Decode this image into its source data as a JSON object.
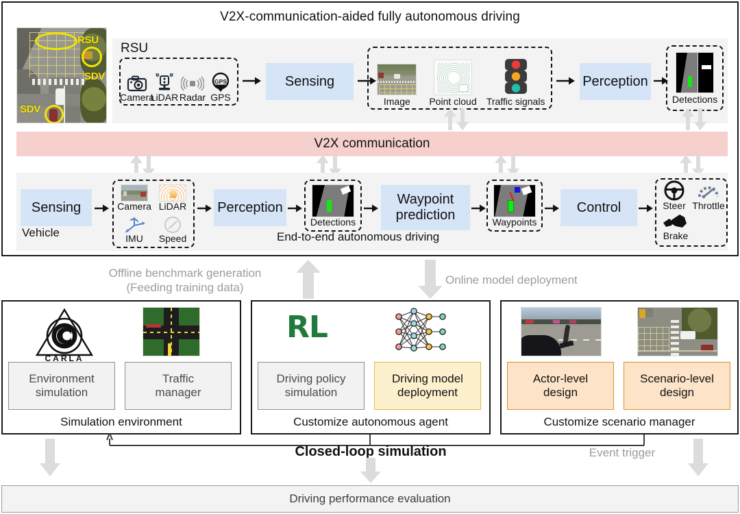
{
  "top": {
    "title": "V2X-communication-aided fully autonomous driving",
    "rsu_label": "RSU",
    "vehicle_label": "Vehicle",
    "e2e_label": "End-to-end autonomous driving",
    "v2x_label": "V2X communication",
    "overview_annotations": [
      {
        "name": "rsu-callout",
        "text": "RSU"
      },
      {
        "name": "sdv-callout-right",
        "text": "SDV"
      },
      {
        "name": "sdv-callout-left",
        "text": "SDV"
      }
    ],
    "rsu_pipeline": {
      "sensors": [
        {
          "icon": "camera-icon",
          "label": "Camera"
        },
        {
          "icon": "lidar-icon",
          "label": "LiDAR"
        },
        {
          "icon": "radar-icon",
          "label": "Radar"
        },
        {
          "icon": "gps-pin-icon",
          "label": "GPS",
          "badge": "GPS"
        }
      ],
      "sensing_box": "Sensing",
      "outputs": [
        {
          "thumb": "street-image-thumb",
          "label": "Image"
        },
        {
          "thumb": "point-cloud-thumb",
          "label": "Point cloud"
        },
        {
          "thumb": "traffic-light-icon",
          "label": "Traffic signals"
        }
      ],
      "perception_box": "Perception",
      "detections": {
        "thumb": "bev-detections-thumb",
        "label": "Detections"
      }
    },
    "vehicle_pipeline": {
      "sensing_box": "Sensing",
      "sensors": [
        {
          "icon": "camera-thumb",
          "label": "Camera"
        },
        {
          "icon": "lidar-heatmap-thumb",
          "label": "LiDAR"
        },
        {
          "icon": "imu-axes-icon",
          "label": "IMU"
        },
        {
          "icon": "speedometer-icon",
          "label": "Speed"
        }
      ],
      "perception_box": "Perception",
      "detections": {
        "thumb": "bev-detections-thumb",
        "label": "Detections"
      },
      "waypoint_box": "Waypoint\nprediction",
      "waypoint_box_line1": "Waypoint",
      "waypoint_box_line2": "prediction",
      "waypoints": {
        "thumb": "bev-waypoints-thumb",
        "label": "Waypoints"
      },
      "control_box": "Control",
      "actuators": [
        {
          "icon": "steering-wheel-icon",
          "label": "Steer"
        },
        {
          "icon": "gauge-icon",
          "label": "Throttle"
        },
        {
          "icon": "brake-pedal-icon",
          "label": "Brake"
        }
      ]
    }
  },
  "middle": {
    "offline_label_line1": "Offline benchmark generation",
    "offline_label_line2": "(Feeding training data)",
    "online_label": "Online model deployment"
  },
  "bottom": {
    "panels": [
      {
        "name": "simulation-environment",
        "caption": "Simulation environment",
        "logo_word": "CARLA",
        "items": [
          {
            "label_line1": "Environment",
            "label_line2": "simulation",
            "style": "gray",
            "thumb": "carla-logo"
          },
          {
            "label_line1": "Traffic",
            "label_line2": "manager",
            "style": "gray",
            "thumb": "traffic-map-thumb"
          }
        ]
      },
      {
        "name": "customize-autonomous-agent",
        "caption": "Customize autonomous agent",
        "rl_text": "RL",
        "items": [
          {
            "label_line1": "Driving policy",
            "label_line2": "simulation",
            "style": "gray",
            "thumb": "rl-text"
          },
          {
            "label_line1": "Driving model",
            "label_line2": "deployment",
            "style": "yellow",
            "thumb": "neural-net-icon"
          }
        ]
      },
      {
        "name": "customize-scenario-manager",
        "caption": "Customize scenario manager",
        "items": [
          {
            "label_line1": "Actor-level",
            "label_line2": "design",
            "style": "orange",
            "thumb": "pedestrian-scene-thumb"
          },
          {
            "label_line1": "Scenario-level",
            "label_line2": "design",
            "style": "orange",
            "thumb": "intersection-scene-thumb"
          }
        ]
      }
    ],
    "closed_loop_label": "Closed-loop simulation",
    "event_trigger_label": "Event trigger",
    "evaluation_label": "Driving performance evaluation"
  },
  "colors": {
    "process_blue": "#d5e4f7",
    "v2x_pink": "#f6d0cc",
    "strip_gray": "#f3f3f3",
    "yellow_box": "#fdf0cd",
    "orange_box": "#fde3c8",
    "gray_arrow": "#dcdcdc",
    "highlight_yellow": "#f5e400",
    "rl_green": "#1f7a3c"
  }
}
